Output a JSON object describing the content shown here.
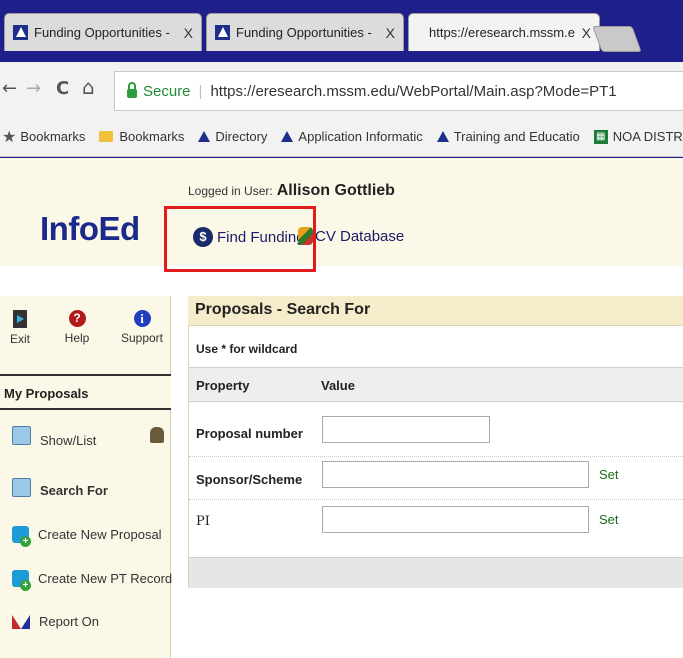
{
  "browser": {
    "tabs": [
      {
        "title": "Funding Opportunities -",
        "close": "X"
      },
      {
        "title": "Funding Opportunities -",
        "close": "X"
      },
      {
        "title": "https://eresearch.mssm.e",
        "close": "X"
      }
    ],
    "nav": {
      "back": "←",
      "forward": "→",
      "reload": "C",
      "home": "⌂"
    },
    "address": {
      "secure_label": "Secure",
      "separator": "|",
      "url": "https://eresearch.mssm.edu/WebPortal/Main.asp?Mode=PT1"
    },
    "bookmarks": [
      {
        "label": "Bookmarks",
        "type": "star"
      },
      {
        "label": "Bookmarks",
        "type": "folder"
      },
      {
        "label": "Directory",
        "type": "site"
      },
      {
        "label": "Application Informatic",
        "type": "site"
      },
      {
        "label": "Training and Educatio",
        "type": "site"
      },
      {
        "label": "NOA DISTRIBUT",
        "type": "sheet"
      }
    ]
  },
  "header": {
    "logged_in_label": "Logged in User:",
    "user_name": "Allison Gottlieb",
    "logo": "InfoEd",
    "find_funding": "Find Funding",
    "cv_database": "CV Database",
    "dollar_glyph": "$"
  },
  "toolbar": {
    "exit": "Exit",
    "help": "Help",
    "help_glyph": "?",
    "support": "Support",
    "support_glyph": "i"
  },
  "sidebar": {
    "section_title": "My Proposals",
    "items": [
      {
        "label": "Show/List",
        "icon": "search-icon"
      },
      {
        "label": "Search For",
        "icon": "search-icon",
        "bold": true
      },
      {
        "label": "Create New Proposal",
        "icon": "add-icon"
      },
      {
        "label": "Create New PT Record",
        "icon": "add-icon"
      },
      {
        "label": "Report On",
        "icon": "report-icon"
      }
    ]
  },
  "search_panel": {
    "title": "Proposals - Search For",
    "hint": "Use * for wildcard",
    "columns": {
      "property": "Property",
      "value": "Value"
    },
    "rows": [
      {
        "label": "Proposal number",
        "value": "",
        "has_set": false
      },
      {
        "label": "Sponsor/Scheme",
        "value": "",
        "has_set": true
      },
      {
        "label": "PI",
        "value": "",
        "has_set": true
      }
    ],
    "set_label": "Set"
  },
  "colors": {
    "highlight": "#e41b1b",
    "brand": "#1a2a8a",
    "background": "#1f1f8c"
  }
}
